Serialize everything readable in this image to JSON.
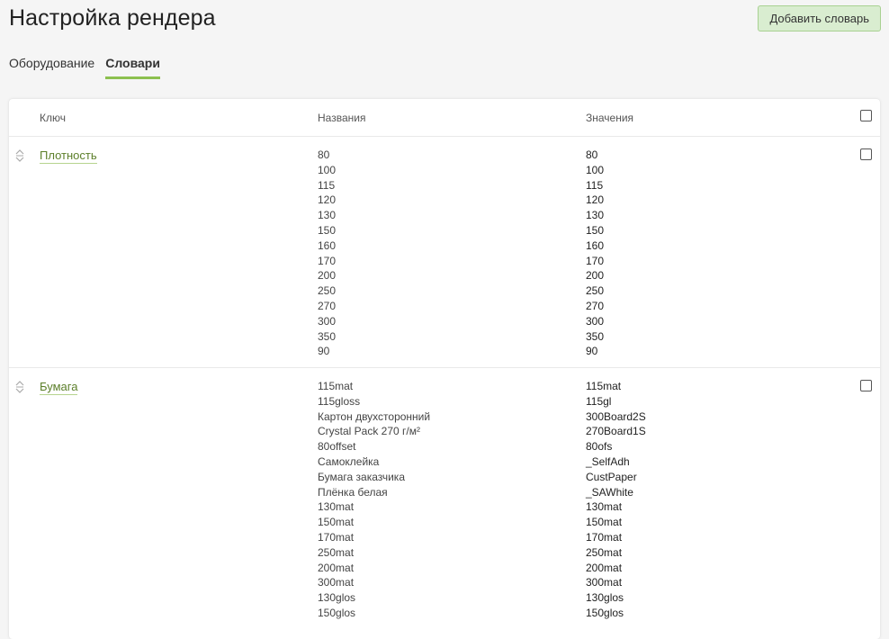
{
  "header": {
    "title": "Настройка рендера",
    "add_button": "Добавить словарь"
  },
  "tabs": [
    {
      "label": "Оборудование",
      "active": false
    },
    {
      "label": "Словари",
      "active": true
    }
  ],
  "table": {
    "columns": {
      "key": "Ключ",
      "names": "Названия",
      "values": "Значения"
    },
    "rows": [
      {
        "key": "Плотность",
        "names": [
          "80",
          "100",
          "115",
          "120",
          "130",
          "150",
          "160",
          "170",
          "200",
          "250",
          "270",
          "300",
          "350",
          "90"
        ],
        "values": [
          "80",
          "100",
          "115",
          "120",
          "130",
          "150",
          "160",
          "170",
          "200",
          "250",
          "270",
          "300",
          "350",
          "90"
        ]
      },
      {
        "key": "Бумага",
        "names": [
          "115mat",
          "115gloss",
          "Картон двухсторонний",
          "Crystal Pack 270 г/м²",
          "80offset",
          "Самоклейка",
          "Бумага заказчика",
          "Плёнка белая",
          "130mat",
          "150mat",
          "170mat",
          "250mat",
          "200mat",
          "300mat",
          "130glos",
          "150glos"
        ],
        "values": [
          "115mat",
          "115gl",
          "300Board2S",
          "270Board1S",
          "80ofs",
          "_SelfAdh",
          "CustPaper",
          "_SAWhite",
          "130mat",
          "150mat",
          "170mat",
          "250mat",
          "200mat",
          "300mat",
          "130glos",
          "150glos"
        ]
      }
    ]
  },
  "colors": {
    "accent": "#8cc04f",
    "link": "#5c7f2a",
    "button_bg": "#d9edd0"
  }
}
